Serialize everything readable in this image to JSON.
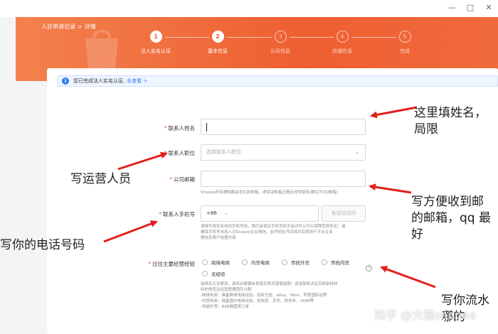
{
  "breadcrumb": {
    "parent": "入驻申请记录",
    "separator": ">",
    "current": "详情"
  },
  "steps": [
    {
      "num": "1",
      "label": "法人实名认证",
      "state": "done"
    },
    {
      "num": "2",
      "label": "基本信息",
      "state": "current"
    },
    {
      "num": "3",
      "label": "公司信息",
      "state": "todo"
    },
    {
      "num": "4",
      "label": "店铺信息",
      "state": "todo"
    },
    {
      "num": "5",
      "label": "完成",
      "state": "todo"
    }
  ],
  "notice": {
    "text": "您已完成法人实名认证,",
    "link": "去查看 >"
  },
  "form": {
    "required_mark": "*",
    "contact_name": {
      "label": "联系人姓名",
      "value": ""
    },
    "contact_position": {
      "label": "联系人职位",
      "placeholder": "选择联系人职位"
    },
    "company_email": {
      "label": "公司邮箱",
      "value": "",
      "help": "Shopee所有通知都会发在此邮箱，请保证邮箱正确且经常使用(建议为QQ邮箱)"
    },
    "contact_phone": {
      "label": "联系人手机号",
      "country_code": "+86",
      "send_code": "发送验证码",
      "help_lines": [
        "请填写真实有效的手机号码，我们会保证手机号码不会对外公开以保障您的安全；请",
        "确保手机号未加入过Shopee企业微信，此号码在开店成功后将用于平台企业",
        "微信及客户经理对接"
      ]
    },
    "experience": {
      "label": "过往主要经营经验",
      "options": [
        "跨境电商",
        "内贸电商",
        "传统外贸",
        "传统内贸",
        "无经验"
      ],
      "help_lines": [
        "选择后无法更改，请务必根据自身真实情况谨慎选择！该选择将决定后续审核材",
        "料的类型及运营管理团队分配",
        "-跨境电商：具备跨境电商经验，如亚马逊、eBay、Wish、阿里国际站等",
        "-内贸电商：具备国内电商经验，如淘宝、京东、拼多多、1688等",
        "-传统外贸：B2B跨国贸订单"
      ]
    }
  },
  "annotations": {
    "name": [
      "这里填姓名，",
      "局限"
    ],
    "position": "写运营人员",
    "email": [
      "写方便收到邮",
      "的邮箱，qq 最",
      "好"
    ],
    "phone": "写你的电话号码",
    "experience": [
      "写你流水",
      "哪的"
    ]
  },
  "watermark": "知乎 @大猫shopee",
  "window_controls": [
    "—",
    "□",
    "✕"
  ]
}
